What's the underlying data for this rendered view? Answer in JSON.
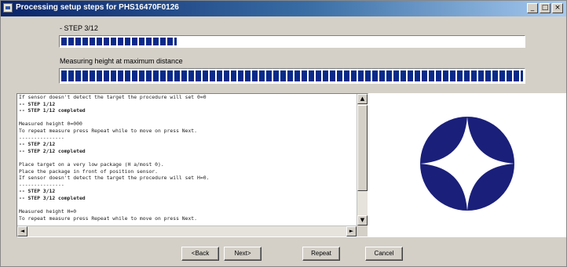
{
  "window": {
    "title": "Processing setup steps for PHS16470F0126",
    "controls": {
      "minimize": "_",
      "maximize": "□",
      "close": "×"
    }
  },
  "progress": {
    "step_label": "- STEP 3/12",
    "step_fraction": 0.25,
    "measure_label": "Measuring height at maximum distance",
    "measure_fraction": 1.0
  },
  "log": {
    "lines": [
      {
        "text": "If sensor doesn't detect the target the procedure will set 0=0",
        "bold": false
      },
      {
        "text": "-- STEP 1/12",
        "bold": true
      },
      {
        "text": "-- STEP 1/12 completed",
        "bold": true
      },
      {
        "text": "",
        "bold": false
      },
      {
        "text": "Measured height 0=000",
        "bold": false
      },
      {
        "text": "To repeat measure press Repeat while to move on press Next.",
        "bold": false
      },
      {
        "text": "---------------",
        "bold": false
      },
      {
        "text": "-- STEP 2/12",
        "bold": true
      },
      {
        "text": "-- STEP 2/12 completed",
        "bold": true
      },
      {
        "text": "",
        "bold": false
      },
      {
        "text": "Place target on a very low package (H a/most 0).",
        "bold": false
      },
      {
        "text": "Place the package in front of position sensor.",
        "bold": false
      },
      {
        "text": "If sensor doesn't detect the target the procedure will set H=0.",
        "bold": false
      },
      {
        "text": "---------------",
        "bold": false
      },
      {
        "text": "-- STEP 3/12",
        "bold": true
      },
      {
        "text": "-- STEP 3/12 completed",
        "bold": true
      },
      {
        "text": "",
        "bold": false
      },
      {
        "text": "Measured height H=0",
        "bold": false
      },
      {
        "text": "To repeat measure press Repeat while to move on press Next.",
        "bold": false
      }
    ],
    "scroll": {
      "up": "▲",
      "down": "▼",
      "left": "◄",
      "right": "►"
    }
  },
  "logo": {
    "icon": "compass-star-logo",
    "color": "#1a1f7a"
  },
  "buttons": {
    "back": "<Back",
    "next": "Next>",
    "repeat": "Repeat",
    "cancel": "Cancel"
  }
}
